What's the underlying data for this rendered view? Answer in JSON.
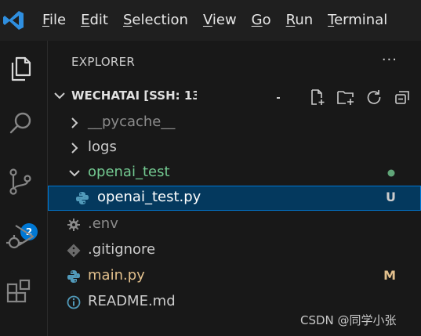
{
  "menu": {
    "items": [
      {
        "key": "F",
        "rest": "ile"
      },
      {
        "key": "E",
        "rest": "dit"
      },
      {
        "key": "S",
        "rest": "election"
      },
      {
        "key": "V",
        "rest": "iew"
      },
      {
        "key": "G",
        "rest": "o"
      },
      {
        "key": "R",
        "rest": "un"
      },
      {
        "key": "T",
        "rest": "erminal"
      }
    ]
  },
  "activity": {
    "source_control_badge": "2"
  },
  "explorer": {
    "title": "EXPLORER",
    "more": "···",
    "workspace": "WECHATAI [SSH: 13",
    "tree": [
      {
        "label": "__pycache__",
        "type": "folder",
        "expanded": false
      },
      {
        "label": "logs",
        "type": "folder",
        "expanded": false
      },
      {
        "label": "openai_test",
        "type": "folder",
        "expanded": true
      },
      {
        "label": "openai_test.py",
        "type": "python",
        "status": "U"
      },
      {
        "label": ".env",
        "type": "gear"
      },
      {
        "label": ".gitignore",
        "type": "git"
      },
      {
        "label": "main.py",
        "type": "python",
        "status": "M"
      },
      {
        "label": "README.md",
        "type": "info"
      }
    ]
  },
  "colors": {
    "accent": "#0078d4",
    "untracked": "#73c991",
    "modified": "#e2c08d",
    "python_icon": "#519aba",
    "selected_bg": "#04395e"
  },
  "watermark": "CSDN @同学小张"
}
